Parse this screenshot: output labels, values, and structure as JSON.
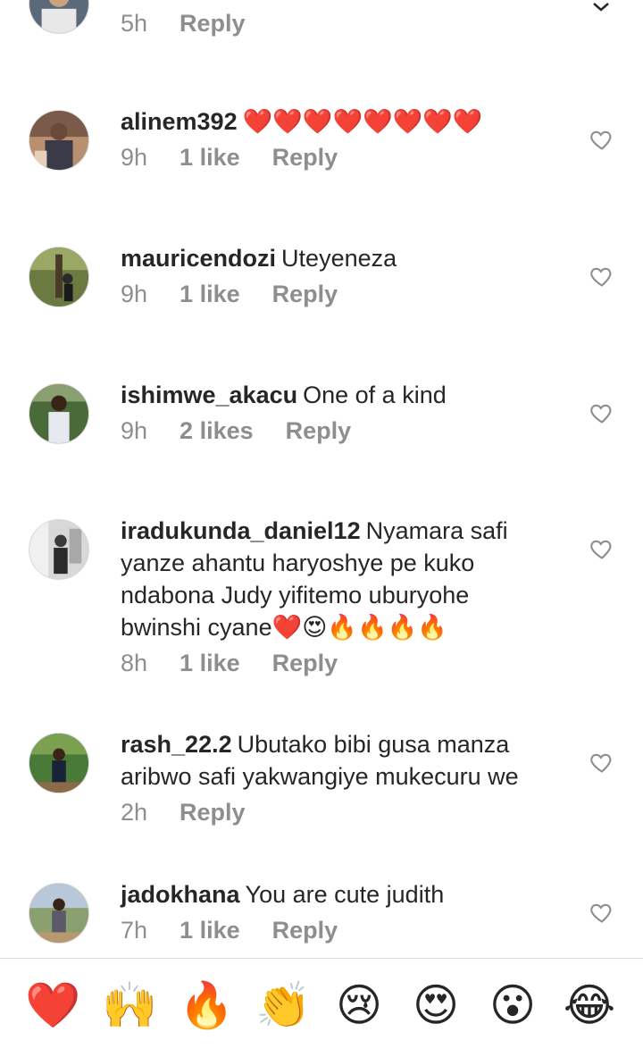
{
  "comments": [
    {
      "user": "",
      "text": "",
      "time": "5h",
      "likes": "",
      "reply": "Reply"
    },
    {
      "user": "alinem392",
      "text": "❤️❤️❤️❤️❤️❤️❤️❤️",
      "time": "9h",
      "likes": "1 like",
      "reply": "Reply"
    },
    {
      "user": "mauricendozi",
      "text": "Uteyeneza",
      "time": "9h",
      "likes": "1 like",
      "reply": "Reply"
    },
    {
      "user": "ishimwe_akacu",
      "text": "One of a kind",
      "time": "9h",
      "likes": "2 likes",
      "reply": "Reply"
    },
    {
      "user": "iradukunda_daniel12",
      "text": "Nyamara safi yanze ahantu haryoshye pe kuko ndabona Judy yifitemo uburyohe bwinshi cyane❤️😍🔥🔥🔥🔥",
      "time": "8h",
      "likes": "1 like",
      "reply": "Reply"
    },
    {
      "user": "rash_22.2",
      "text": "Ubutako bibi gusa manza aribwo safi yakwangiye mukecuru we",
      "time": "2h",
      "likes": "",
      "reply": "Reply"
    },
    {
      "user": "jadokhana",
      "text": "You are cute judith",
      "time": "7h",
      "likes": "1 like",
      "reply": "Reply"
    }
  ],
  "reactions": [
    "❤️",
    "🙌",
    "🔥",
    "👏",
    "😢",
    "😍",
    "😮",
    "😂"
  ],
  "colors": {
    "primary_text": "#262626",
    "secondary_text": "#8e8e8e",
    "divider": "#dbdbdb"
  }
}
